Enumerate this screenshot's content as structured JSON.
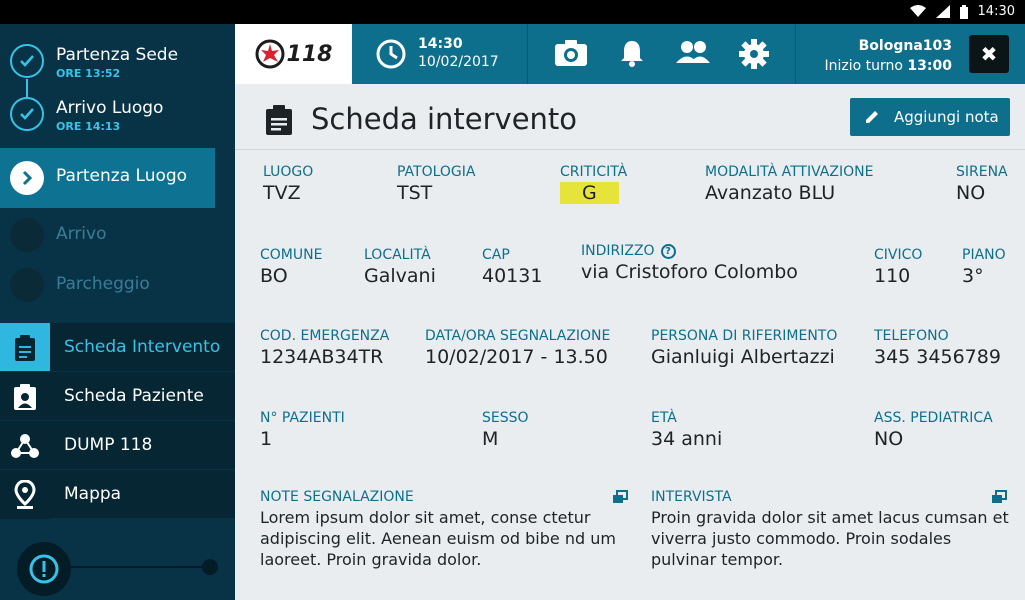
{
  "status_bar": {
    "time": "14:30",
    "icons": [
      "wifi-icon",
      "signal-icon",
      "battery-icon"
    ]
  },
  "steps": [
    {
      "title": "Partenza Sede",
      "time": "ORE 13:52",
      "state": "done"
    },
    {
      "title": "Arrivo Luogo",
      "time": "ORE 14:13",
      "state": "done"
    },
    {
      "title": "Partenza Luogo",
      "state": "active"
    },
    {
      "title": "Arrivo",
      "state": "pending"
    },
    {
      "title": "Parcheggio",
      "state": "pending"
    }
  ],
  "nav": [
    {
      "label": "Scheda Intervento",
      "icon": "clipboard-icon",
      "active": true
    },
    {
      "label": "Scheda Paziente",
      "icon": "patient-card-icon"
    },
    {
      "label": "DUMP 118",
      "icon": "network-icon"
    },
    {
      "label": "Mappa",
      "icon": "map-pin-icon"
    }
  ],
  "topbar": {
    "logo_text": "118",
    "time": "14:30",
    "date": "10/02/2017",
    "icons": [
      "camera-icon",
      "bell-icon",
      "team-icon",
      "gear-icon"
    ],
    "station_name": "Bologna103",
    "shift_label": "Inizio turno",
    "shift_time": "13:00",
    "close": "✖"
  },
  "page": {
    "title": "Scheda intervento",
    "add_note": "Aggiungi nota"
  },
  "fields": {
    "luogo": {
      "label": "LUOGO",
      "value": "TVZ"
    },
    "patologia": {
      "label": "PATOLOGIA",
      "value": "TST"
    },
    "criticita": {
      "label": "CRITICITÀ",
      "value": "G",
      "color": "#e6e43b"
    },
    "modalita": {
      "label": "MODALITÀ ATTIVAZIONE",
      "value": "Avanzato BLU"
    },
    "sirena": {
      "label": "SIRENA",
      "value": "NO"
    },
    "comune": {
      "label": "COMUNE",
      "value": "BO"
    },
    "localita": {
      "label": "LOCALITÀ",
      "value": "Galvani"
    },
    "cap": {
      "label": "CAP",
      "value": "40131"
    },
    "indirizzo": {
      "label": "INDIRIZZO",
      "value": "via Cristoforo Colombo",
      "help": "?"
    },
    "civico": {
      "label": "CIVICO",
      "value": "110"
    },
    "piano": {
      "label": "PIANO",
      "value": "3°"
    },
    "cod_emergenza": {
      "label": "COD. EMERGENZA",
      "value": "1234AB34TR"
    },
    "data_ora": {
      "label": "DATA/ORA SEGNALAZIONE",
      "value": "10/02/2017 - 13.50"
    },
    "persona": {
      "label": "PERSONA DI RIFERIMENTO",
      "value": "Gianluigi Albertazzi"
    },
    "telefono": {
      "label": "TELEFONO",
      "value": "345 3456789"
    },
    "n_pazienti": {
      "label": "N° PAZIENTI",
      "value": "1"
    },
    "sesso": {
      "label": "SESSO",
      "value": "M"
    },
    "eta": {
      "label": "ETÀ",
      "value": "34 anni"
    },
    "ass_pediatrica": {
      "label": "ASS. PEDIATRICA",
      "value": "NO"
    },
    "note": {
      "label": "NOTE SEGNALAZIONE",
      "value": "Lorem ipsum dolor sit amet, conse ctetur adipiscing elit. Aenean euism od bibe nd um laoreet. Proin gravida dolor."
    },
    "intervista": {
      "label": "INTERVISTA",
      "value": "Proin gravida dolor sit amet lacus cumsan et viverra justo commodo. Proin sodales pulvinar tempor."
    }
  },
  "colors": {
    "accent": "#0e6f8d",
    "cyan": "#37c3e8",
    "sidebar": "#083347",
    "highlight": "#e6e43b"
  }
}
